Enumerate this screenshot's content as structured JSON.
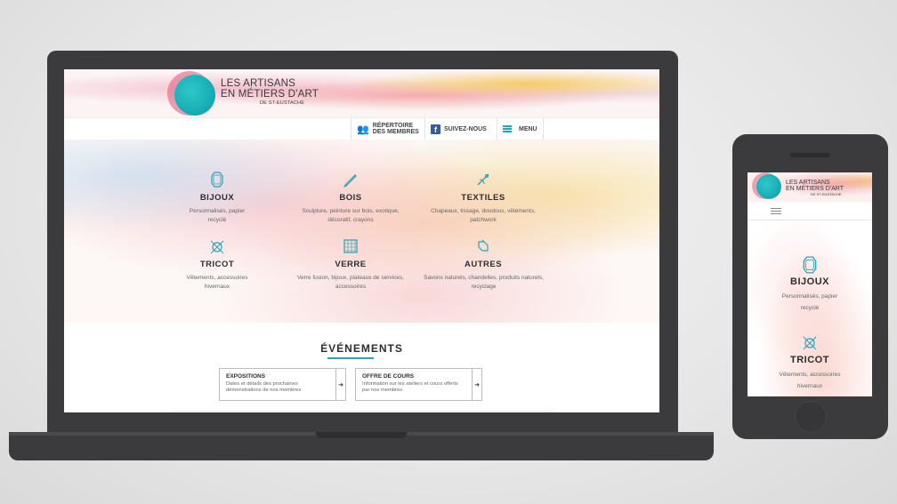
{
  "site": {
    "logo_line1": "LES ARTISANS",
    "logo_line2": "EN MÉTIERS D'ART",
    "logo_line3": "DE ST-EUSTACHE",
    "nav": {
      "repertoire_line1": "RÉPERTOIRE",
      "repertoire_line2": "DES MEMBRES",
      "suivez": "SUIVEZ-NOUS",
      "menu": "MENU"
    },
    "categories": [
      {
        "title": "BIJOUX",
        "desc": "Personnalisés, papier recyclé",
        "icon": "gem-icon"
      },
      {
        "title": "BOIS",
        "desc": "Sculpture, peinture sur bois, exotique, décoratif, crayons",
        "icon": "pencil-icon"
      },
      {
        "title": "TEXTILES",
        "desc": "Chapeaux, tissage, doudous, vêtements, patchwork",
        "icon": "needle-icon"
      },
      {
        "title": "TRICOT",
        "desc": "Vêtements, accessoires hivernaux",
        "icon": "yarn-icon"
      },
      {
        "title": "VERRE",
        "desc": "Verre fusion, bijoux, plateaux de services, accessoires",
        "icon": "glass-tile-icon"
      },
      {
        "title": "AUTRES",
        "desc": "Savons naturels, chandelles, produits naturels, recyclage",
        "icon": "brush-icon"
      }
    ],
    "events": {
      "title": "ÉVÉNEMENTS",
      "cards": [
        {
          "title": "EXPOSITIONS",
          "desc": "Dates et détails des prochaines démonstrations de nos membres",
          "arrow": "➜"
        },
        {
          "title": "OFFRE DE COURS",
          "desc": "Information sur les ateliers et cours offerts par nos membres",
          "arrow": "➜"
        }
      ]
    }
  },
  "mobile": {
    "categories": [
      {
        "title": "BIJOUX",
        "desc_line1": "Personnalisés, papier",
        "desc_line2": "recyclé",
        "icon": "gem-icon"
      },
      {
        "title": "TRICOT",
        "desc_line1": "Vêtements, accessoires",
        "desc_line2": "hivernaux",
        "icon": "yarn-icon"
      }
    ]
  },
  "colors": {
    "accent": "#2aa3b5",
    "device": "#3b3b3d",
    "facebook": "#3b5a98"
  }
}
